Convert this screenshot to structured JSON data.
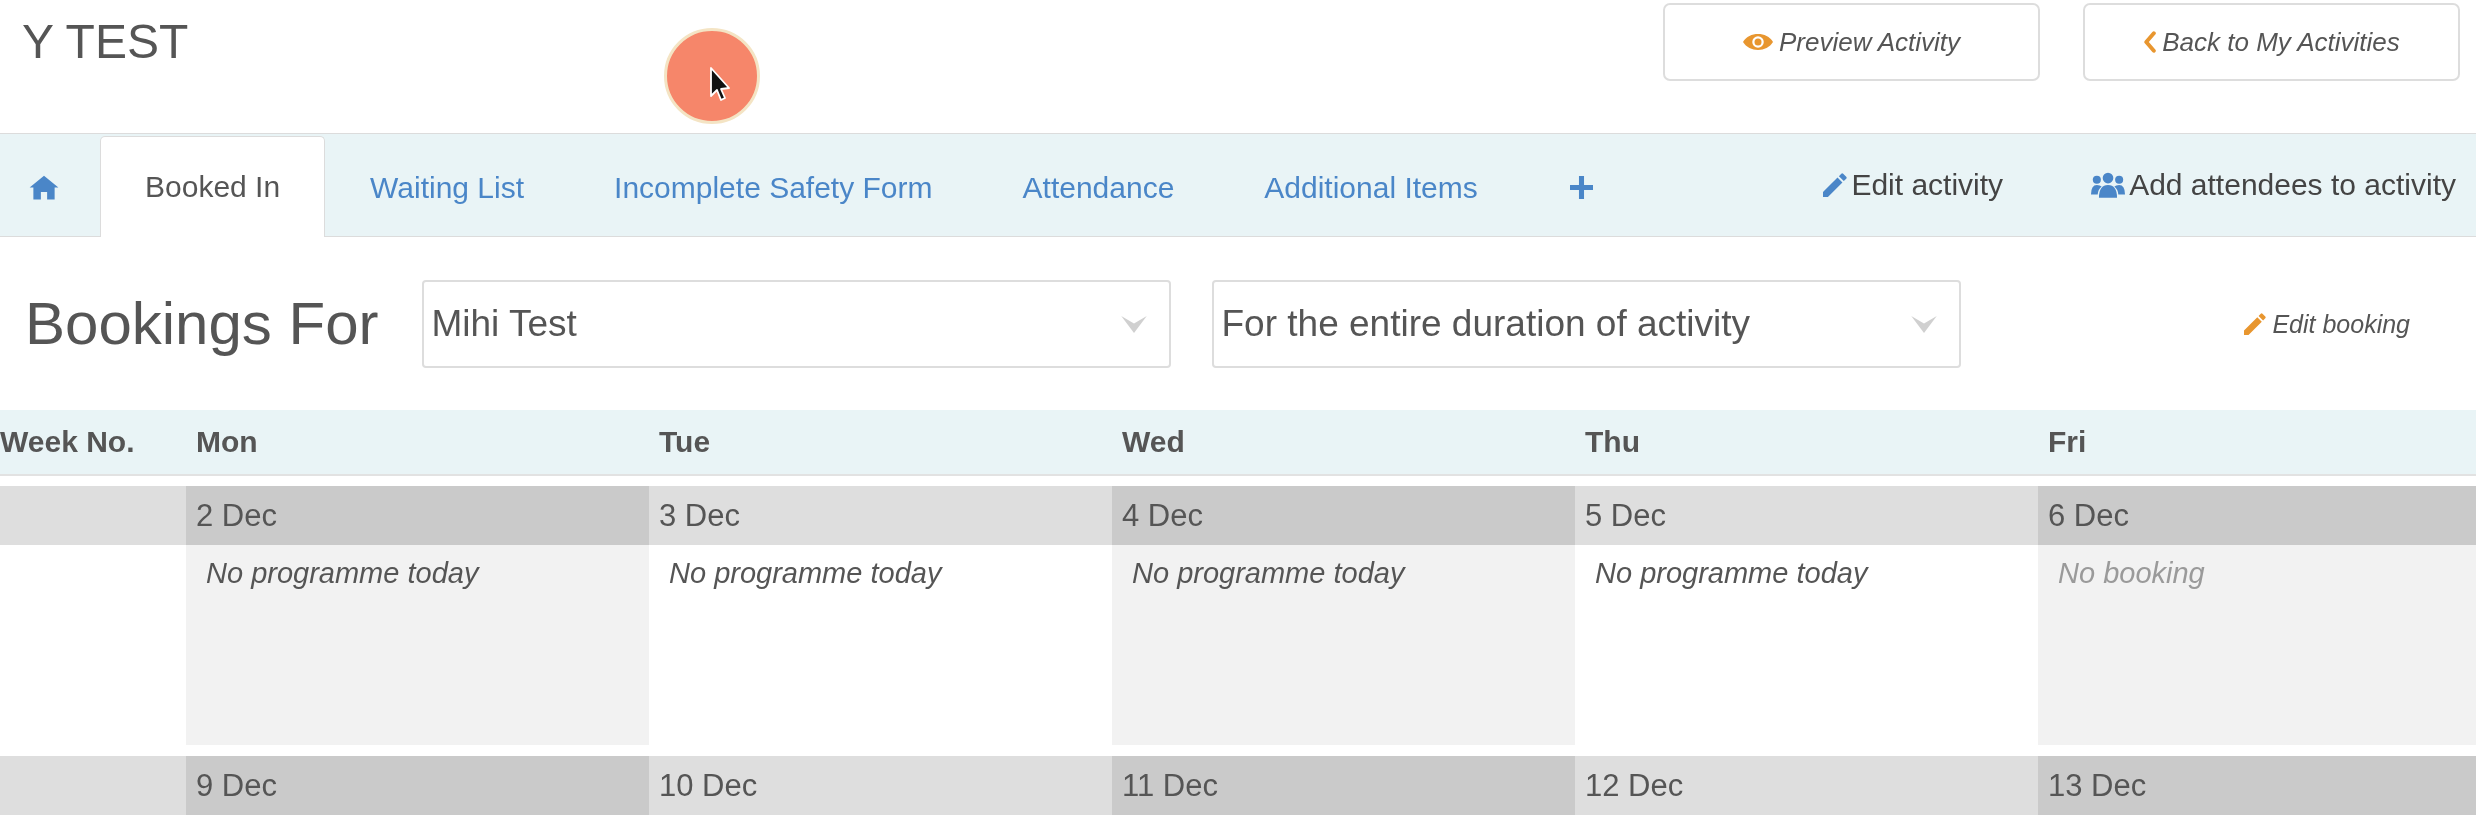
{
  "header": {
    "title": "Y TEST",
    "buttons": [
      {
        "label": "Preview Activity"
      },
      {
        "label": "Back to My Activities"
      }
    ]
  },
  "tabs": [
    {
      "kind": "home",
      "selected": false
    },
    {
      "kind": "tab",
      "label": "Booked In",
      "selected": true
    },
    {
      "kind": "tab",
      "label": "Waiting List",
      "selected": false
    },
    {
      "kind": "tab",
      "label": "Incomplete Safety Form",
      "selected": false
    },
    {
      "kind": "tab",
      "label": "Attendance",
      "selected": false
    },
    {
      "kind": "tab",
      "label": "Additional Items",
      "selected": false
    },
    {
      "kind": "add",
      "selected": false
    }
  ],
  "actions": [
    {
      "label": "Edit activity"
    },
    {
      "label": "Add attendees to activity"
    }
  ],
  "bookings": {
    "heading": "Bookings For",
    "person_select": {
      "value": "Mihi Test"
    },
    "period_select": {
      "value": "For the entire duration of activity"
    },
    "edit_link": "Edit booking"
  },
  "calendar": {
    "columns": [
      "Week No.",
      "Mon",
      "Tue",
      "Wed",
      "Thu",
      "Fri"
    ],
    "weeks": [
      {
        "days": [
          {
            "date": "2 Dec",
            "note": "No programme today",
            "muted": false
          },
          {
            "date": "3 Dec",
            "note": "No programme today",
            "muted": false
          },
          {
            "date": "4 Dec",
            "note": "No programme today",
            "muted": false
          },
          {
            "date": "5 Dec",
            "note": "No programme today",
            "muted": false
          },
          {
            "date": "6 Dec",
            "note": "No booking",
            "muted": true
          }
        ]
      },
      {
        "days": [
          {
            "date": "9 Dec"
          },
          {
            "date": "10 Dec"
          },
          {
            "date": "11 Dec"
          },
          {
            "date": "12 Dec"
          },
          {
            "date": "13 Dec"
          }
        ]
      }
    ]
  }
}
